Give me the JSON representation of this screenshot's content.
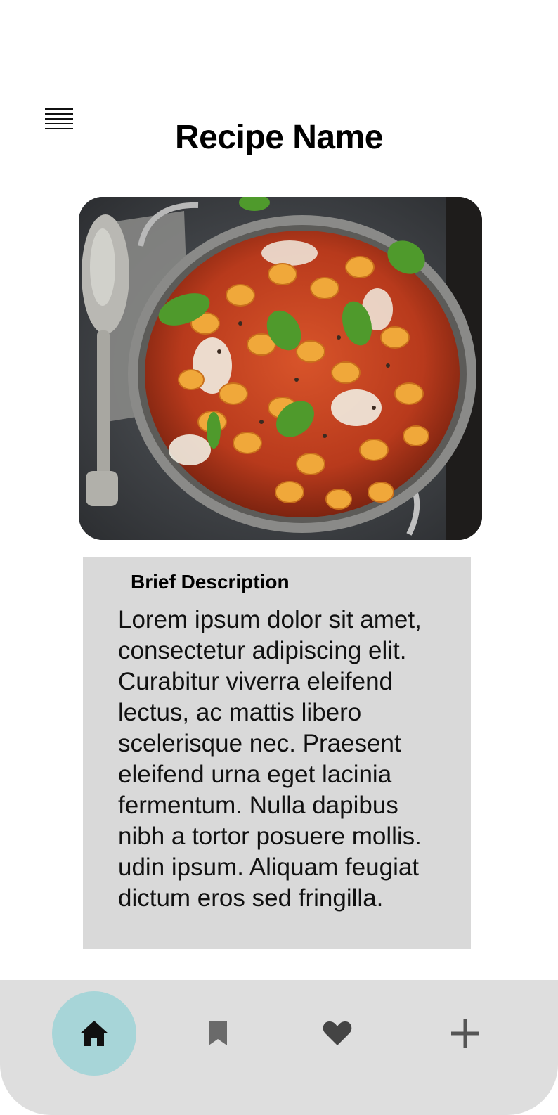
{
  "header": {
    "title": "Recipe Name",
    "menu_icon": "hamburger-icon"
  },
  "hero": {
    "image_subject": "gnocchi-bake-photo",
    "carousel_indicator_color": "#ffffff"
  },
  "description": {
    "title": "Brief Description",
    "body": "Lorem ipsum dolor sit amet,\nconsectetur adipiscing elit.\nCurabitur viverra eleifend\n lectus, ac mattis libero\nscelerisque nec. Praesent\neleifend urna eget lacinia\nfermentum. Nulla dapibus\nnibh a tortor posuere mollis.\nudin ipsum. Aliquam feugiat\ndictum eros sed fringilla.",
    "background_color": "#d9d9d9"
  },
  "bottom_nav": {
    "background_color": "#dedede",
    "active_color": "#a7d5d8",
    "items": [
      {
        "icon": "home-icon",
        "active": true
      },
      {
        "icon": "bookmark-icon",
        "active": false
      },
      {
        "icon": "heart-icon",
        "active": false
      },
      {
        "icon": "plus-icon",
        "active": false
      }
    ]
  }
}
